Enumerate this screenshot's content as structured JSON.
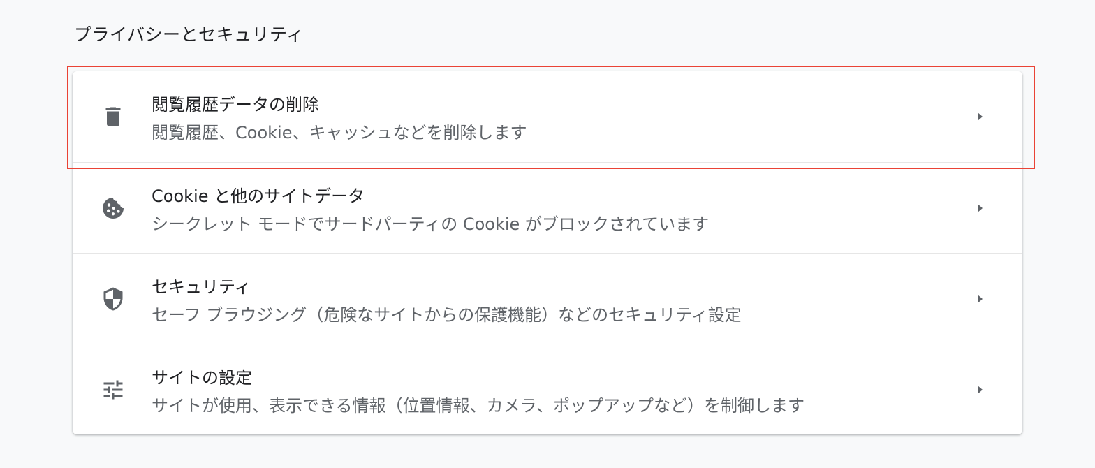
{
  "section": {
    "title": "プライバシーとセキュリティ"
  },
  "rows": [
    {
      "title": "閲覧履歴データの削除",
      "subtitle": "閲覧履歴、Cookie、キャッシュなどを削除します",
      "icon": "trash-icon"
    },
    {
      "title": "Cookie と他のサイトデータ",
      "subtitle": "シークレット モードでサードパーティの Cookie がブロックされています",
      "icon": "cookie-icon"
    },
    {
      "title": "セキュリティ",
      "subtitle": "セーフ ブラウジング（危険なサイトからの保護機能）などのセキュリティ設定",
      "icon": "shield-icon"
    },
    {
      "title": "サイトの設定",
      "subtitle": "サイトが使用、表示できる情報（位置情報、カメラ、ポップアップなど）を制御します",
      "icon": "tune-icon"
    }
  ],
  "colors": {
    "background": "#f8f9fa",
    "card": "#ffffff",
    "title_text": "#202124",
    "subtitle_text": "#5f6368",
    "icon": "#5f6368",
    "highlight": "#ea4335"
  }
}
